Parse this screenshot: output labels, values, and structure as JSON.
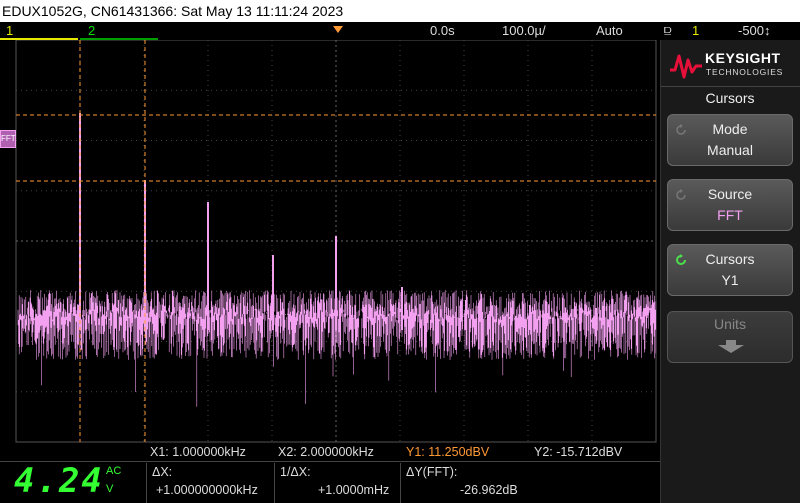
{
  "title_bar": {
    "text": "EDUX1052G, CN61431366: Sat May 13 11:11:24 2023"
  },
  "status": {
    "ch1": "1",
    "ch2": "2",
    "time_offset": "0.0s",
    "time_scale": "100.0µ/",
    "trigger_mode": "Auto",
    "trigger_channel": "1",
    "trigger_level": "-500↕"
  },
  "brand": {
    "name": "KEYSIGHT",
    "sub": "TECHNOLOGIES"
  },
  "menu": {
    "title": "Cursors",
    "softkeys": [
      {
        "label": "Mode",
        "value": "Manual"
      },
      {
        "label": "Source",
        "value": "FFT"
      },
      {
        "label": "Cursors",
        "value": "Y1"
      },
      {
        "label": "Units",
        "value": ""
      }
    ]
  },
  "fft_marker": "FFT",
  "readout": {
    "x1": "X1:  1.000000kHz",
    "x2": "X2:  2.000000kHz",
    "y1": "Y1:  11.250dBV",
    "y2": "Y2: -15.712dBV",
    "dx_label": "ΔX:",
    "dx_value": "+1.000000000kHz",
    "inv_dx_label": "1/ΔX:",
    "inv_dx_value": "+1.0000mHz",
    "dy_label": "ΔY(FFT):",
    "dy_value": "-26.962dB",
    "meter_value": "4.24",
    "meter_ac": "AC",
    "meter_unit": "V"
  },
  "colors": {
    "ch1": "#e8e800",
    "ch2": "#00e000",
    "fft": "#f3a0f0",
    "cursor": "#ff9933",
    "meter": "#33ff33"
  }
}
